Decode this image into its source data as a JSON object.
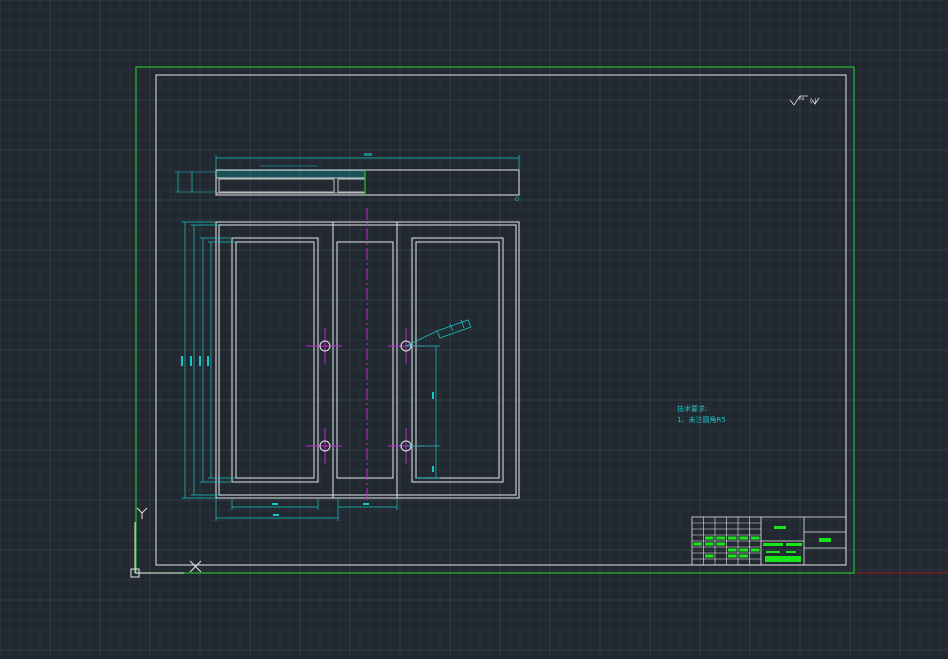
{
  "colors": {
    "background": "#212830",
    "grid_minor": "#2a323b",
    "grid_major": "#333d48",
    "border_outer": "#22c02a",
    "sheet_frame": "#e6e6e6",
    "part_lines": "#e6e6e6",
    "dimension": "#13c7c7",
    "centerline": "#c428c8",
    "title_block_fill": "#19e619",
    "axis_x_red": "#a01d1d"
  },
  "ucs": {
    "y_label": "Y",
    "x_label": "X"
  },
  "notes": {
    "heading": "技术要求:",
    "line1": "1、未注圆角R5"
  },
  "surface_symbol": {
    "text": "√ᴿᵃ ( √ )"
  },
  "icons": {
    "ucs": "ucs-axis-icon",
    "surface": "surface-roughness-icon"
  }
}
